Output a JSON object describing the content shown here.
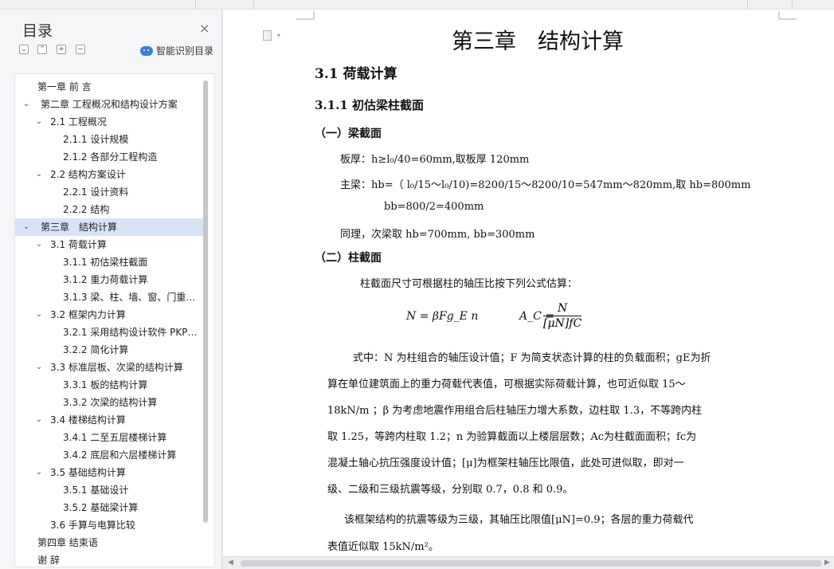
{
  "toc": {
    "title": "目录",
    "close_icon": "×",
    "smart_label": "智能识别目录",
    "items": [
      {
        "label": "第一章 前 言",
        "level": 0,
        "chevron": ""
      },
      {
        "label": "第二章 工程概况和结构设计方案",
        "level": 0,
        "chevron": "⌄"
      },
      {
        "label": "2.1 工程概况",
        "level": 1,
        "chevron": "⌄"
      },
      {
        "label": "2.1.1 设计规模",
        "level": 2,
        "chevron": ""
      },
      {
        "label": "2.1.2 各部分工程构造",
        "level": 2,
        "chevron": ""
      },
      {
        "label": "2.2 结构方案设计",
        "level": 1,
        "chevron": "⌄"
      },
      {
        "label": "2.2.1 设计资料",
        "level": 2,
        "chevron": ""
      },
      {
        "label": "2.2.2 结构",
        "level": 2,
        "chevron": ""
      },
      {
        "label": "第三章　结构计算",
        "level": 0,
        "chevron": "⌄",
        "selected": true
      },
      {
        "label": "3.1 荷载计算",
        "level": 1,
        "chevron": "⌄"
      },
      {
        "label": "3.1.1 初估梁柱截面",
        "level": 2,
        "chevron": ""
      },
      {
        "label": "3.1.2 重力荷载计算",
        "level": 2,
        "chevron": ""
      },
      {
        "label": "3.1.3 梁、柱、墙、窗、门重…",
        "level": 2,
        "chevron": ""
      },
      {
        "label": "3.2 框架内力计算",
        "level": 1,
        "chevron": "⌄"
      },
      {
        "label": "3.2.1 采用结构设计软件 PKP…",
        "level": 2,
        "chevron": ""
      },
      {
        "label": "3.2.2 简化计算",
        "level": 2,
        "chevron": ""
      },
      {
        "label": "3.3 标准层板、次梁的结构计算",
        "level": 1,
        "chevron": "⌄"
      },
      {
        "label": "3.3.1 板的结构计算",
        "level": 2,
        "chevron": ""
      },
      {
        "label": "3.3.2 次梁的结构计算",
        "level": 2,
        "chevron": ""
      },
      {
        "label": "3.4 楼梯结构计算",
        "level": 1,
        "chevron": "⌄"
      },
      {
        "label": "3.4.1 二至五层楼梯计算",
        "level": 2,
        "chevron": ""
      },
      {
        "label": "3.4.2 底层和六层楼梯计算",
        "level": 2,
        "chevron": ""
      },
      {
        "label": "3.5 基础结构计算",
        "level": 1,
        "chevron": "⌄"
      },
      {
        "label": "3.5.1 基础设计",
        "level": 2,
        "chevron": ""
      },
      {
        "label": "3.5.2 基础梁计算",
        "level": 2,
        "chevron": ""
      },
      {
        "label": "3.6 手算与电算比较",
        "level": 1,
        "chevron": ""
      },
      {
        "label": "第四章 结束语",
        "level": 0,
        "chevron": ""
      },
      {
        "label": "谢 辞",
        "level": 0,
        "chevron": ""
      }
    ]
  },
  "doc": {
    "chapter_title": "第三章　结构计算",
    "section": "3.1 荷载计算",
    "subsection": "3.1.1 初估梁柱截面",
    "part1": "（一）梁截面",
    "slab": "板厚：h≥l₀/40=60mm,取板厚 120mm",
    "main_beam": "主梁：hb=（ l₀/15～l₀/10)=8200/15～8200/10=547mm～820mm,取 hb=800mm",
    "main_beam_b": "bb=800/2=400mm",
    "secondary_beam": "同理，次梁取 hb=700mm,  bb=300mm",
    "part2": "（二）柱截面",
    "column_intro": "柱截面尺寸可根据柱的轴压比按下列公式估算：",
    "formula1": "N = βFg_E n",
    "formula2_lhs": "A_C =",
    "formula2_num": "N",
    "formula2_den": "[μN]fC",
    "explain_1": "式中：N 为柱组合的轴压设计值；F 为简支状态计算的柱的负载面积；gE为折",
    "explain_2": "算在单位建筑面上的重力荷载代表值，可根据实际荷载计算，也可近似取 15～",
    "explain_3": "18kN/m ；β 为考虑地震作用组合后柱轴压力增大系数，边柱取 1.3，不等跨内柱",
    "explain_4": "取 1.25，等跨内柱取 1.2；n 为验算截面以上楼层层数；Ac为柱截面面积；fc为",
    "explain_5": "混凝土轴心抗压强度设计值；[μ]为框架柱轴压比限值，此处可进似取，即对一",
    "explain_6": "级、二级和三级抗震等级，分别取 0.7，0.8 和 0.9。",
    "frame_1": "该框架结构的抗震等级为三级，其轴压比限值[μN]=0.9；各层的重力荷载代",
    "frame_2": "表值近似取 15kN/m²。"
  }
}
